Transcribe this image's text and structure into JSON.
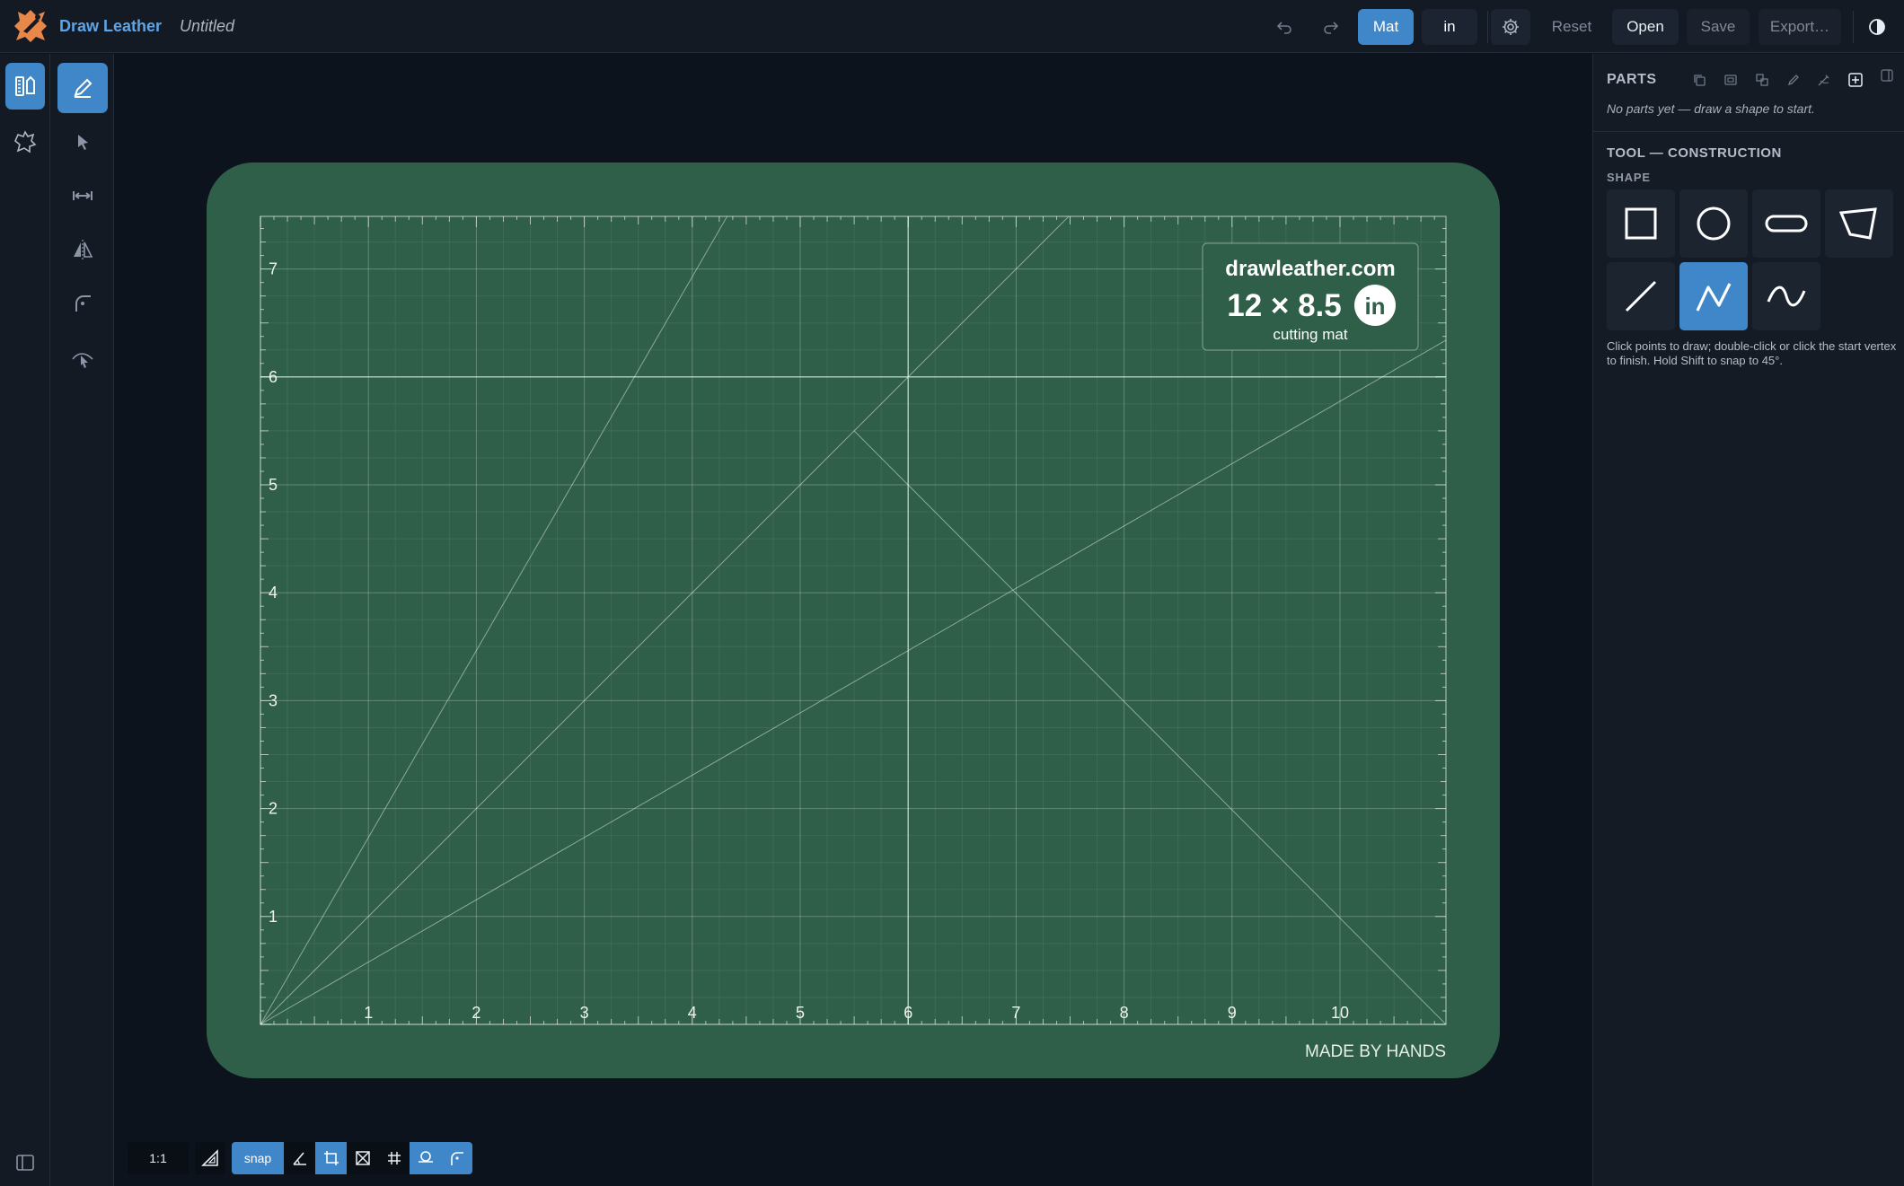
{
  "header": {
    "app_name": "Draw Leather",
    "doc_title": "Untitled",
    "mode_mat": "Mat",
    "units": "in",
    "reset": "Reset",
    "open": "Open",
    "save": "Save",
    "export": "Export…"
  },
  "rail_tools": [
    "pen",
    "select",
    "measure",
    "mirror",
    "round-corner",
    "edit-node"
  ],
  "mat": {
    "brand": "drawleather.com",
    "size": "12 × 8.5",
    "unit_badge": "in",
    "caption": "cutting mat",
    "footer": "MADE BY HANDS",
    "x_ticks": [
      "1",
      "2",
      "3",
      "4",
      "5",
      "6",
      "7",
      "8",
      "9",
      "10"
    ],
    "y_ticks": [
      "1",
      "2",
      "3",
      "4",
      "5",
      "6",
      "7"
    ],
    "color": "#2f5f48"
  },
  "bottom": {
    "zoom": "1:1",
    "snap": "snap"
  },
  "panel": {
    "parts_title": "PARTS",
    "parts_empty": "No parts yet — draw a shape to start.",
    "tool_title": "TOOL — CONSTRUCTION",
    "shape_label": "SHAPE",
    "shapes": [
      "rectangle",
      "circle",
      "slot",
      "polygon",
      "line",
      "polyline",
      "curve"
    ],
    "active_shape": "polyline",
    "hint": "Click points to draw; double-click or click the start vertex to finish. Hold Shift to snap to 45°."
  },
  "colors": {
    "accent": "#3f87c9",
    "mat_green": "#2f5f48",
    "brand_blue": "#5ea4e8"
  }
}
